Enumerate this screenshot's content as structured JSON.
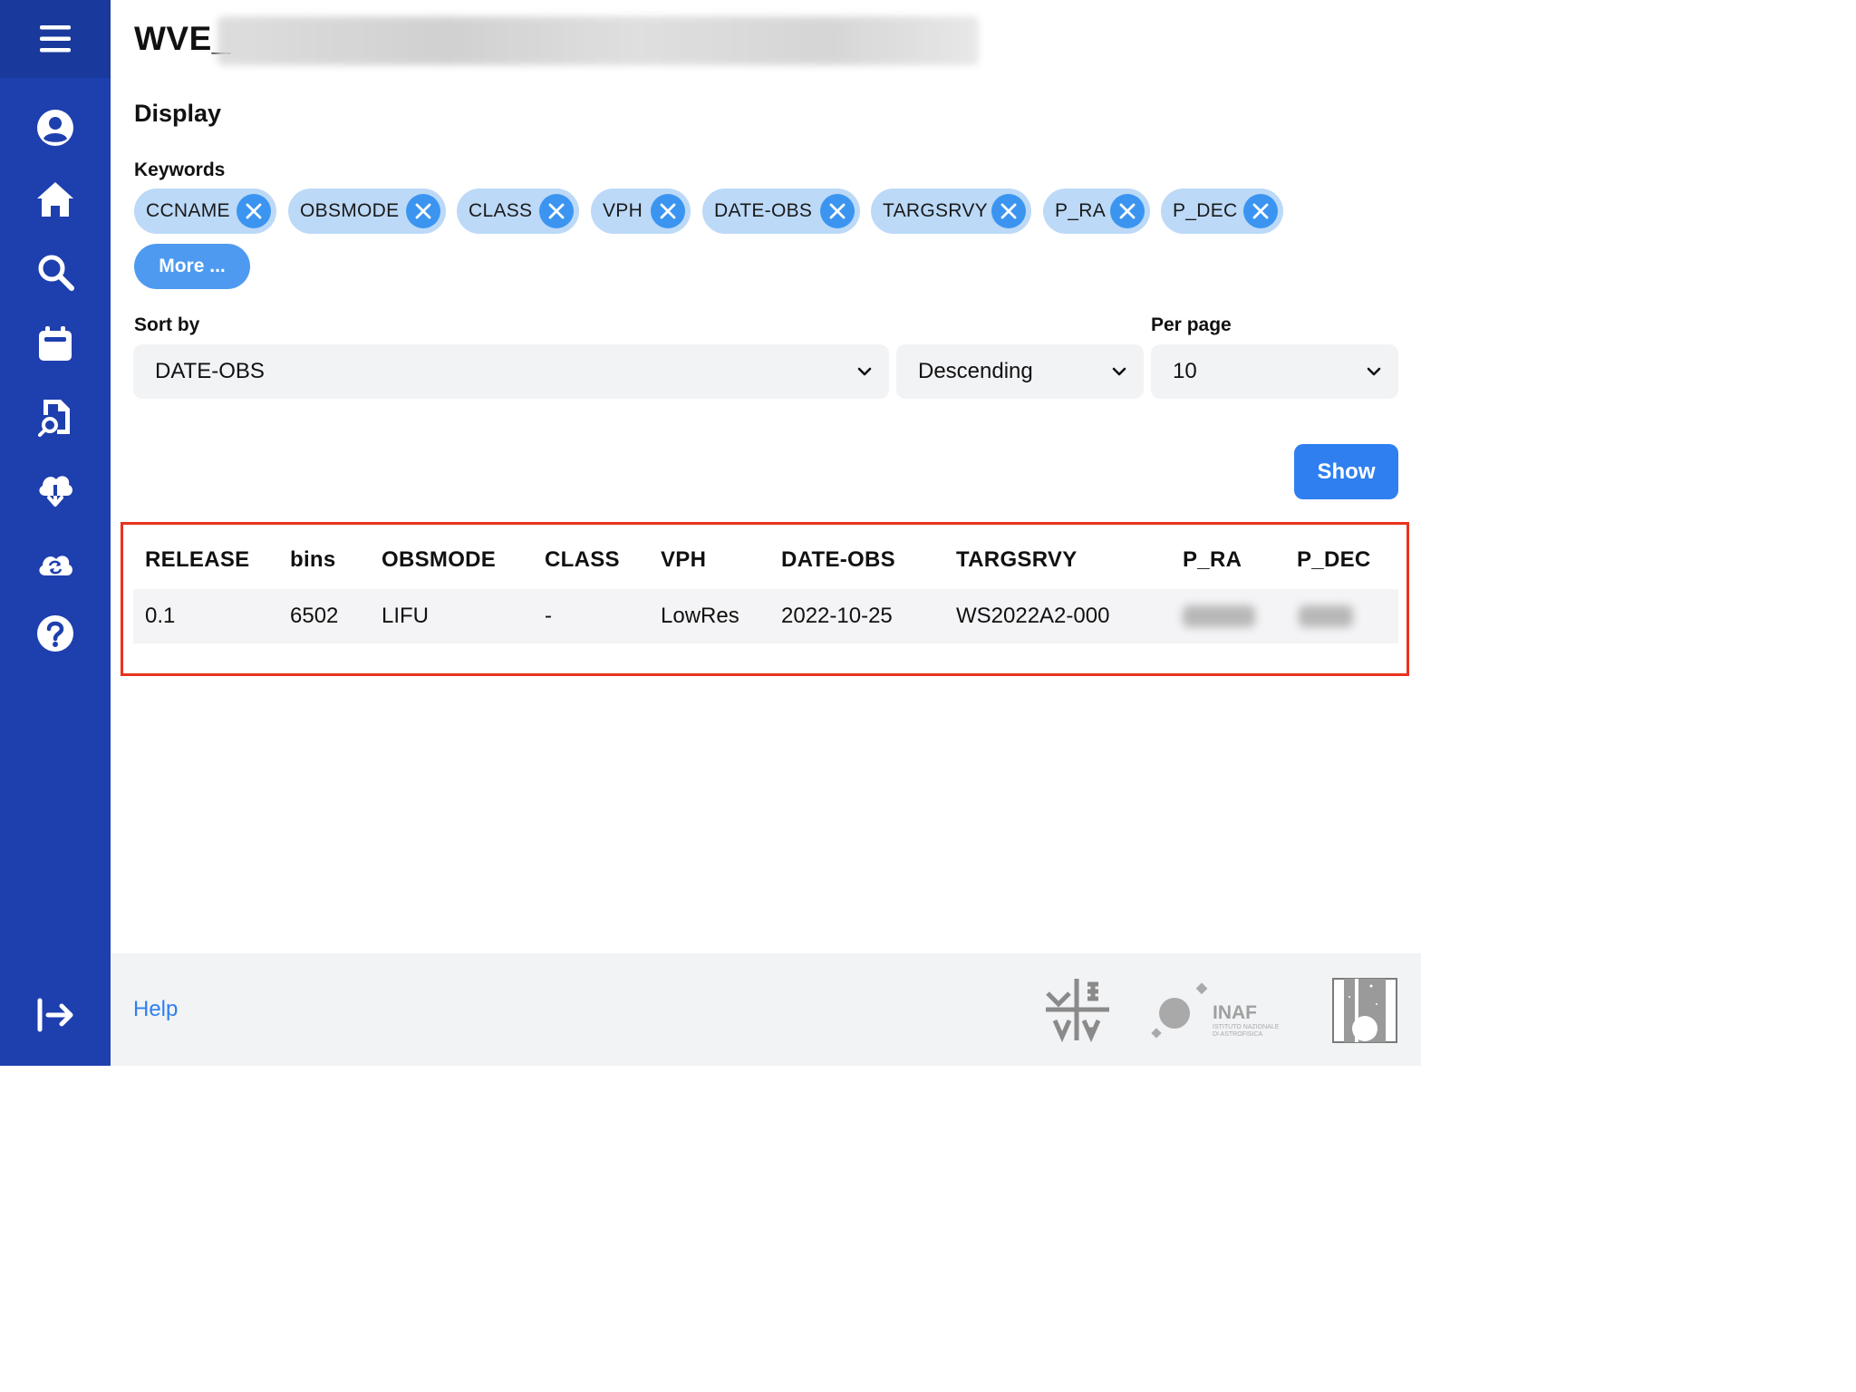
{
  "page": {
    "title": "WVE_"
  },
  "display": {
    "heading": "Display",
    "keywords_label": "Keywords",
    "keywords": [
      "CCNAME",
      "OBSMODE",
      "CLASS",
      "VPH",
      "DATE-OBS",
      "TARGSRVY",
      "P_RA",
      "P_DEC"
    ],
    "more_label": "More ...",
    "sort_by_label": "Sort by",
    "sort_by_value": "DATE-OBS",
    "order_value": "Descending",
    "per_page_label": "Per page",
    "per_page_value": "10",
    "show_label": "Show"
  },
  "table": {
    "columns": [
      "RELEASE",
      "bins",
      "OBSMODE",
      "CLASS",
      "VPH",
      "DATE-OBS",
      "TARGSRVY",
      "P_RA",
      "P_DEC"
    ],
    "rows": [
      [
        "0.1",
        "6502",
        "LIFU",
        "-",
        "LowRes",
        "2022-10-25",
        "WS2022A2-000",
        "",
        ""
      ]
    ]
  },
  "footer": {
    "help_label": "Help",
    "inaf_name": "INAF",
    "inaf_subtitle_1": "ISTITUTO NAZIONALE",
    "inaf_subtitle_2": "DI ASTROFISICA"
  },
  "colors": {
    "sidebar": "#1e3fae",
    "chip": "#bcd9f7",
    "chip_close": "#3b95f0",
    "primary": "#2f7ff0",
    "highlight": "#e8321e"
  },
  "icons": [
    "menu-icon",
    "user-icon",
    "home-icon",
    "search-icon",
    "calendar-icon",
    "file-search-icon",
    "cloud-download-icon",
    "cloud-sync-icon",
    "help-icon",
    "logout-icon"
  ]
}
